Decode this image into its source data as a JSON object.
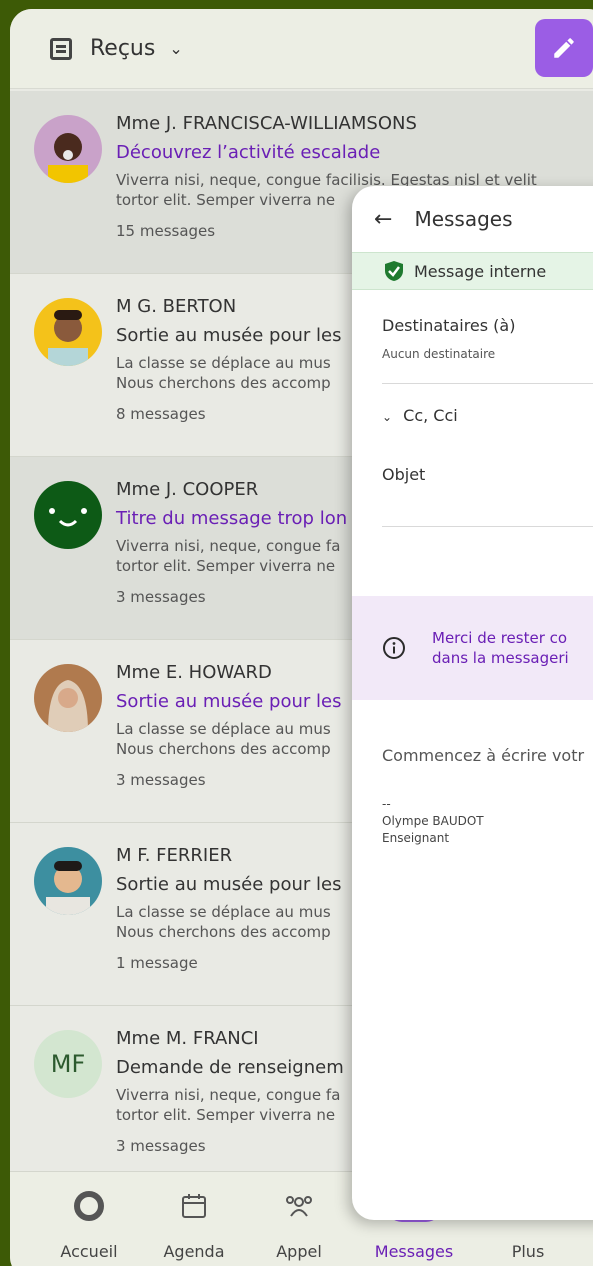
{
  "header": {
    "title": "Reçus"
  },
  "messages": [
    {
      "sender": "Mme J. FRANCISCA-WILLIAMSONS",
      "subject": "Découvrez l’activité escalade",
      "preview1": "Viverra nisi, neque, congue facilisis. Egestas nisl et velit",
      "preview2": "tortor elit. Semper viverra ne",
      "count": "15 messages"
    },
    {
      "sender": "M G. BERTON",
      "subject": "Sortie au musée pour les",
      "preview1": "La classe se déplace au mus",
      "preview2": "Nous cherchons des accomp",
      "count": "8 messages"
    },
    {
      "sender": "Mme J. COOPER",
      "subject": "Titre du message trop lon",
      "preview1": "Viverra nisi, neque, congue fa",
      "preview2": "tortor elit. Semper viverra ne",
      "count": "3 messages"
    },
    {
      "sender": "Mme E. HOWARD",
      "subject": "Sortie au musée pour les",
      "preview1": "La classe se déplace au mus",
      "preview2": "Nous cherchons des accomp",
      "count": "3 messages"
    },
    {
      "sender": "M F. FERRIER",
      "subject": "Sortie au musée pour les",
      "preview1": "La classe se déplace au mus",
      "preview2": "Nous cherchons des accomp",
      "count": "1 message"
    },
    {
      "sender": "Mme M. FRANCI",
      "initials": "MF",
      "subject": "Demande de renseignem",
      "preview1": "Viverra nisi, neque, congue fa",
      "preview2": "tortor elit. Semper viverra ne",
      "count": "3 messages"
    }
  ],
  "nav": {
    "home": "Accueil",
    "agenda": "Agenda",
    "call": "Appel",
    "messages": "Messages",
    "more": "Plus"
  },
  "compose": {
    "title": "Messages",
    "internal": "Message interne",
    "recipients_label": "Destinataires (à)",
    "recipients_value": "Aucun destinataire",
    "cc_label": "Cc, Cci",
    "subject_label": "Objet",
    "info_line1": "Merci de rester co",
    "info_line2": "dans la messageri",
    "body_placeholder": "Commencez à écrire votr",
    "sig_dash": "--",
    "sig_name": "Olympe BAUDOT",
    "sig_role": "Enseignant"
  },
  "colors": {
    "accent": "#6a1fb5",
    "compose_button": "#9b5de5",
    "internal_banner": "#e5f4e6",
    "info_banner": "#f2e9f8",
    "background": "#3d5a06"
  }
}
